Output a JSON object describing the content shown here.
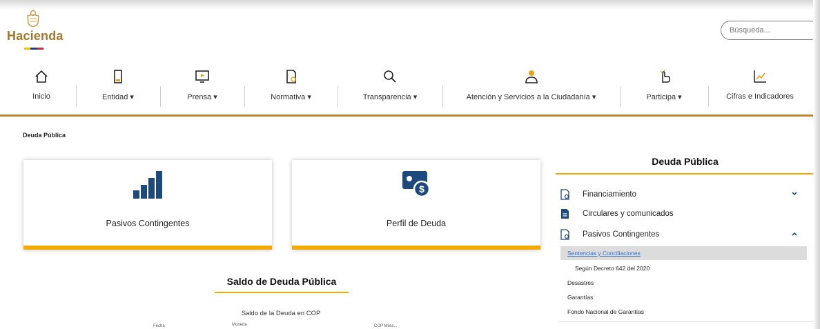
{
  "header": {
    "brand": "Hacienda",
    "flag_colors": [
      "#f2c200",
      "#1b3f8f",
      "#d42a2a"
    ],
    "search_placeholder": "Búsqueda..."
  },
  "nav": {
    "items": [
      {
        "label": "Inicio",
        "icon": "home-icon"
      },
      {
        "label": "Entidad ▾",
        "icon": "building-icon"
      },
      {
        "label": "Prensa ▾",
        "icon": "monitor-play-icon"
      },
      {
        "label": "Normativa ▾",
        "icon": "document-edit-icon"
      },
      {
        "label": "Transparencia ▾",
        "icon": "search-icon"
      },
      {
        "label": "Atención y Servicios a la Ciudadanía ▾",
        "icon": "user-icon"
      },
      {
        "label": "Participa ▾",
        "icon": "hand-pointer-icon"
      },
      {
        "label": "Cifras e Indicadores",
        "icon": "chart-trend-icon"
      }
    ],
    "accent": "#b9852f",
    "icon_accent": "#e5a21f"
  },
  "breadcrumb": "Deuda Pública",
  "cards": [
    {
      "label": "Pasivos Contingentes",
      "icon": "bar-chart-icon"
    },
    {
      "label": "Perfil de Deuda",
      "icon": "money-icon"
    }
  ],
  "saldo": {
    "title": "Saldo de Deuda Pública",
    "subtitle": "Saldo de la Deuda en COP",
    "col_fecha": "Fecha",
    "col_moneda": "Moneda",
    "col_cop": "COP Miles..."
  },
  "sidebar": {
    "title": "Deuda Pública",
    "items": [
      {
        "label": "Financiamiento",
        "icon": "document-gear-icon",
        "expanded": false
      },
      {
        "label": "Circulares y comunicados",
        "icon": "document-list-icon",
        "expanded": false
      },
      {
        "label": "Pasivos Contingentes",
        "icon": "document-gear-icon",
        "expanded": true
      }
    ],
    "sub_items": [
      "Sentencias y Conciliaciones",
      "Según Decreto 642 del 2020",
      "Desastres",
      "Garantías",
      "Fondo Nacional de Garantías"
    ],
    "active_color": "#3c6ec2"
  },
  "colors": {
    "brand": "#a5772b",
    "yellow": "#f2a900",
    "navy": "#1c4a7e"
  }
}
